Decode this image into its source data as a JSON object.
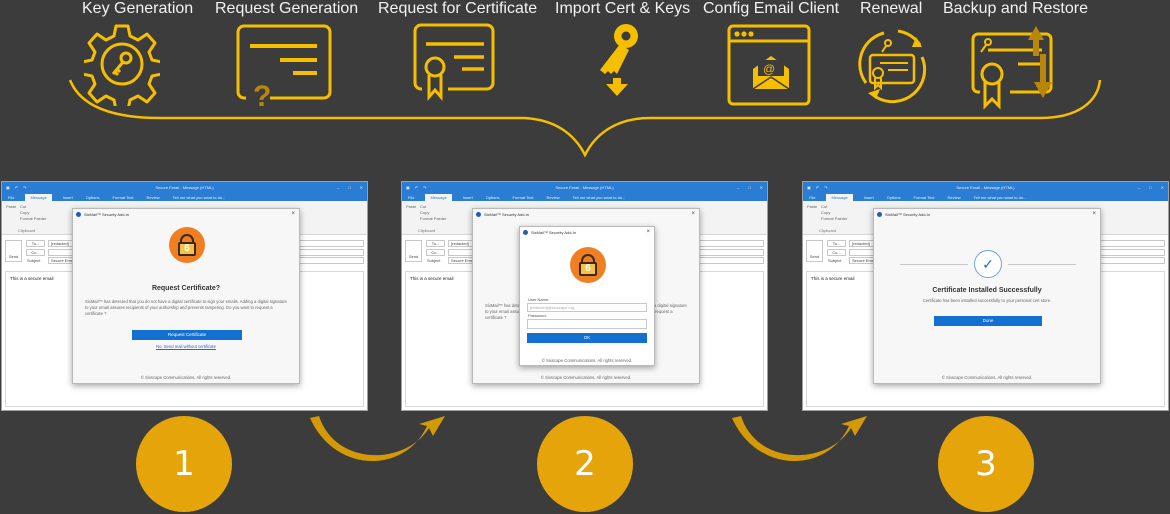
{
  "steps_top": [
    {
      "label": "Key Generation",
      "icon": "gear-key-icon"
    },
    {
      "label": "Request Generation",
      "icon": "certificate-question-icon"
    },
    {
      "label": "Request for Certificate",
      "icon": "certificate-ribbon-icon"
    },
    {
      "label": "Import Cert & Keys",
      "icon": "key-download-icon"
    },
    {
      "label": "Config Email Client",
      "icon": "email-window-icon"
    },
    {
      "label": "Renewal",
      "icon": "certificate-renew-icon"
    },
    {
      "label": "Backup and Restore",
      "icon": "certificate-backup-icon"
    }
  ],
  "colors": {
    "background": "#3c3c3c",
    "accent": "#f5bf00",
    "step_circle": "#e5a50a",
    "outlook_blue": "#2b7cd3",
    "button_blue": "#1470d0"
  },
  "outlook": {
    "window_title": "Secure Email - Message (HTML)",
    "tabs": [
      "File",
      "Message",
      "Insert",
      "Options",
      "Format Text",
      "Review"
    ],
    "tell_me": "Tell me what you want to do...",
    "clipboard": {
      "paste": "Paste",
      "cut": "Cut",
      "copy": "Copy",
      "format_painter": "Format Painter",
      "group": "Clipboard"
    },
    "send": "Send",
    "to": "To...",
    "cc": "Cc...",
    "subject_label": "Subject",
    "to_value": "[redacted]",
    "subject_value": "Secure Email",
    "body": "This is a secure email"
  },
  "panels": [
    {
      "step": "1",
      "dialog_title": "SixMail™ Security Add-In",
      "heading": "Request Certificate?",
      "text": "SixMail™ has detected that you do not have a digital certificate to sign your emails. Adding a digital signature to your email assures recipients of your authorship and prevents tampering. Do you want to request a certificate ?",
      "primary_button": "Request Certificate",
      "link": "No, Send mail without certificate",
      "footer": "© Sixscape Communications. All rights reserved."
    },
    {
      "step": "2",
      "dialog_title": "SixMail™ Security Add-In",
      "outer_text": "SixMail™ has detected that you do not have a digital certificate to sign your emails. Adding a digital signature to your email assures recipients of your authorship and prevents tampering. Do you want to request a certificate ?",
      "username_label": "User Name:",
      "username_value": "[redacted]@sixscape.org",
      "password_label": "Password:",
      "password_value": "",
      "primary_button": "OK",
      "footer": "© Sixscape Communications. All rights reserved."
    },
    {
      "step": "3",
      "dialog_title": "SixMail™ Security Add-In",
      "heading": "Certificate Installed Successfully",
      "text": "Certificate has been installed successfully to your personal cert store.",
      "primary_button": "Done",
      "footer": "© Sixscape Communications. All rights reserved."
    }
  ],
  "lock_digit": "6"
}
